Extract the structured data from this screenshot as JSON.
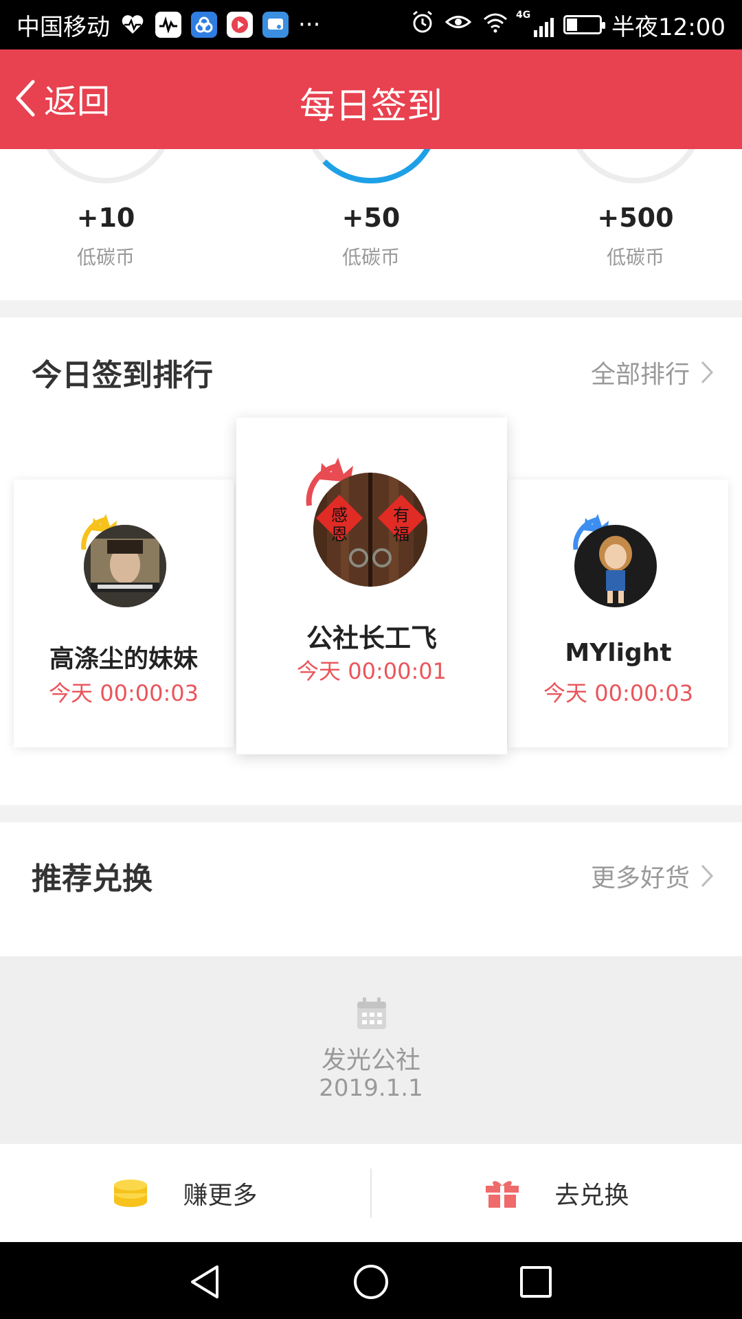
{
  "status_bar": {
    "carrier": "中国移动",
    "more": "···",
    "network": "4G",
    "time": "半夜12:00"
  },
  "header": {
    "back_label": "返回",
    "title": "每日签到"
  },
  "rewards": [
    {
      "points": "+10",
      "unit": "低碳币"
    },
    {
      "points": "+50",
      "unit": "低碳币"
    },
    {
      "points": "+500",
      "unit": "低碳币"
    }
  ],
  "ranking": {
    "title": "今日签到排行",
    "more_label": "全部排行",
    "users": [
      {
        "name": "公社长工飞",
        "time": "今天 00:00:01",
        "crown_color": "#e84b52",
        "avatar_caption": [
          "感恩",
          "有福"
        ]
      },
      {
        "name": "高涤尘的妹妹",
        "time": "今天 00:00:03",
        "crown_color": "#f6c21b"
      },
      {
        "name": "MYlight",
        "time": "今天 00:00:03",
        "crown_color": "#3d8ef0"
      }
    ]
  },
  "recommend": {
    "title": "推荐兑换",
    "more_label": "更多好货",
    "placeholder_name": "发光公社",
    "placeholder_date": "2019.1.1"
  },
  "bottom_actions": {
    "earn_label": "赚更多",
    "exchange_label": "去兑换"
  },
  "colors": {
    "header": "#e8414f",
    "time_text": "#e9555a",
    "progress": "#1ea0e6"
  }
}
